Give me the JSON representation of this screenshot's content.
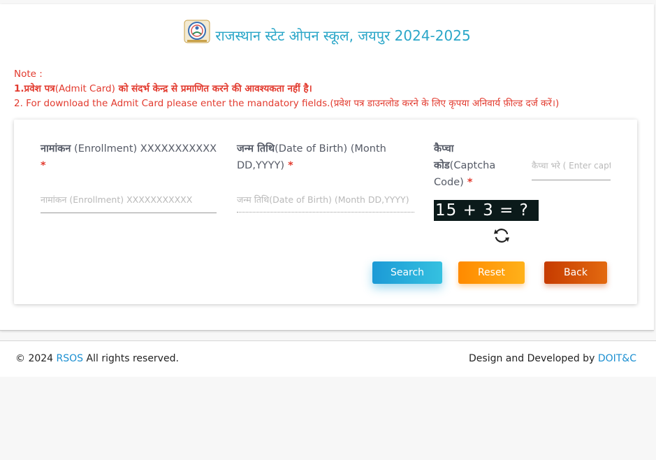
{
  "header": {
    "title": "राजस्थान स्टेट ओपन स्कूल, जयपुर 2024-2025"
  },
  "note": {
    "heading": "Note :",
    "line1_prefix": "1.प्रवेश पत्र",
    "line1_en": "(Admit Card)",
    "line1_suffix": " को संदर्भ केन्द्र से प्रमाणित करने की आवश्यकता नहीं है।",
    "line2": "2. For download the Admit Card please enter the mandatory fields.(प्रवेश पत्र डाउनलोड करने के लिए कृपया अनिवार्य फ़ील्ड दर्ज करें।)"
  },
  "form": {
    "enrollment": {
      "label_hi": "नामांकन",
      "label_en": " (Enrollment) XXXXXXXXXXX",
      "required": " *",
      "placeholder": "नामांकन (Enrollment) XXXXXXXXXXX",
      "value": ""
    },
    "dob": {
      "label_hi": "जन्म तिथि",
      "label_en": "(Date of Birth) (Month DD,YYYY)",
      "required": " *",
      "placeholder": "जन्म तिथि(Date of Birth) (Month DD,YYYY)",
      "value": ""
    },
    "captcha": {
      "label_hi1": "कैप्चा",
      "label_hi2": "कोड",
      "label_en": "(Captcha Code)",
      "required": " *",
      "placeholder": "कैप्चा भरे ( Enter captcha )",
      "value": "",
      "question": "15 + 3 = ?"
    }
  },
  "buttons": {
    "search": "Search",
    "reset": "Reset",
    "back": "Back"
  },
  "footer": {
    "copyright_prefix": "© 2024 ",
    "rsos_link": "RSOS",
    "copyright_suffix": " All rights reserved.",
    "designed_by": "Design and Developed by ",
    "doit_link": "DOIT&C"
  },
  "colors": {
    "title": "#2aa6c8",
    "note": "#e23a2e",
    "search": "#1c9ad6",
    "reset": "#ff8a00",
    "back": "#c63b00",
    "link": "#1b8fd1"
  }
}
